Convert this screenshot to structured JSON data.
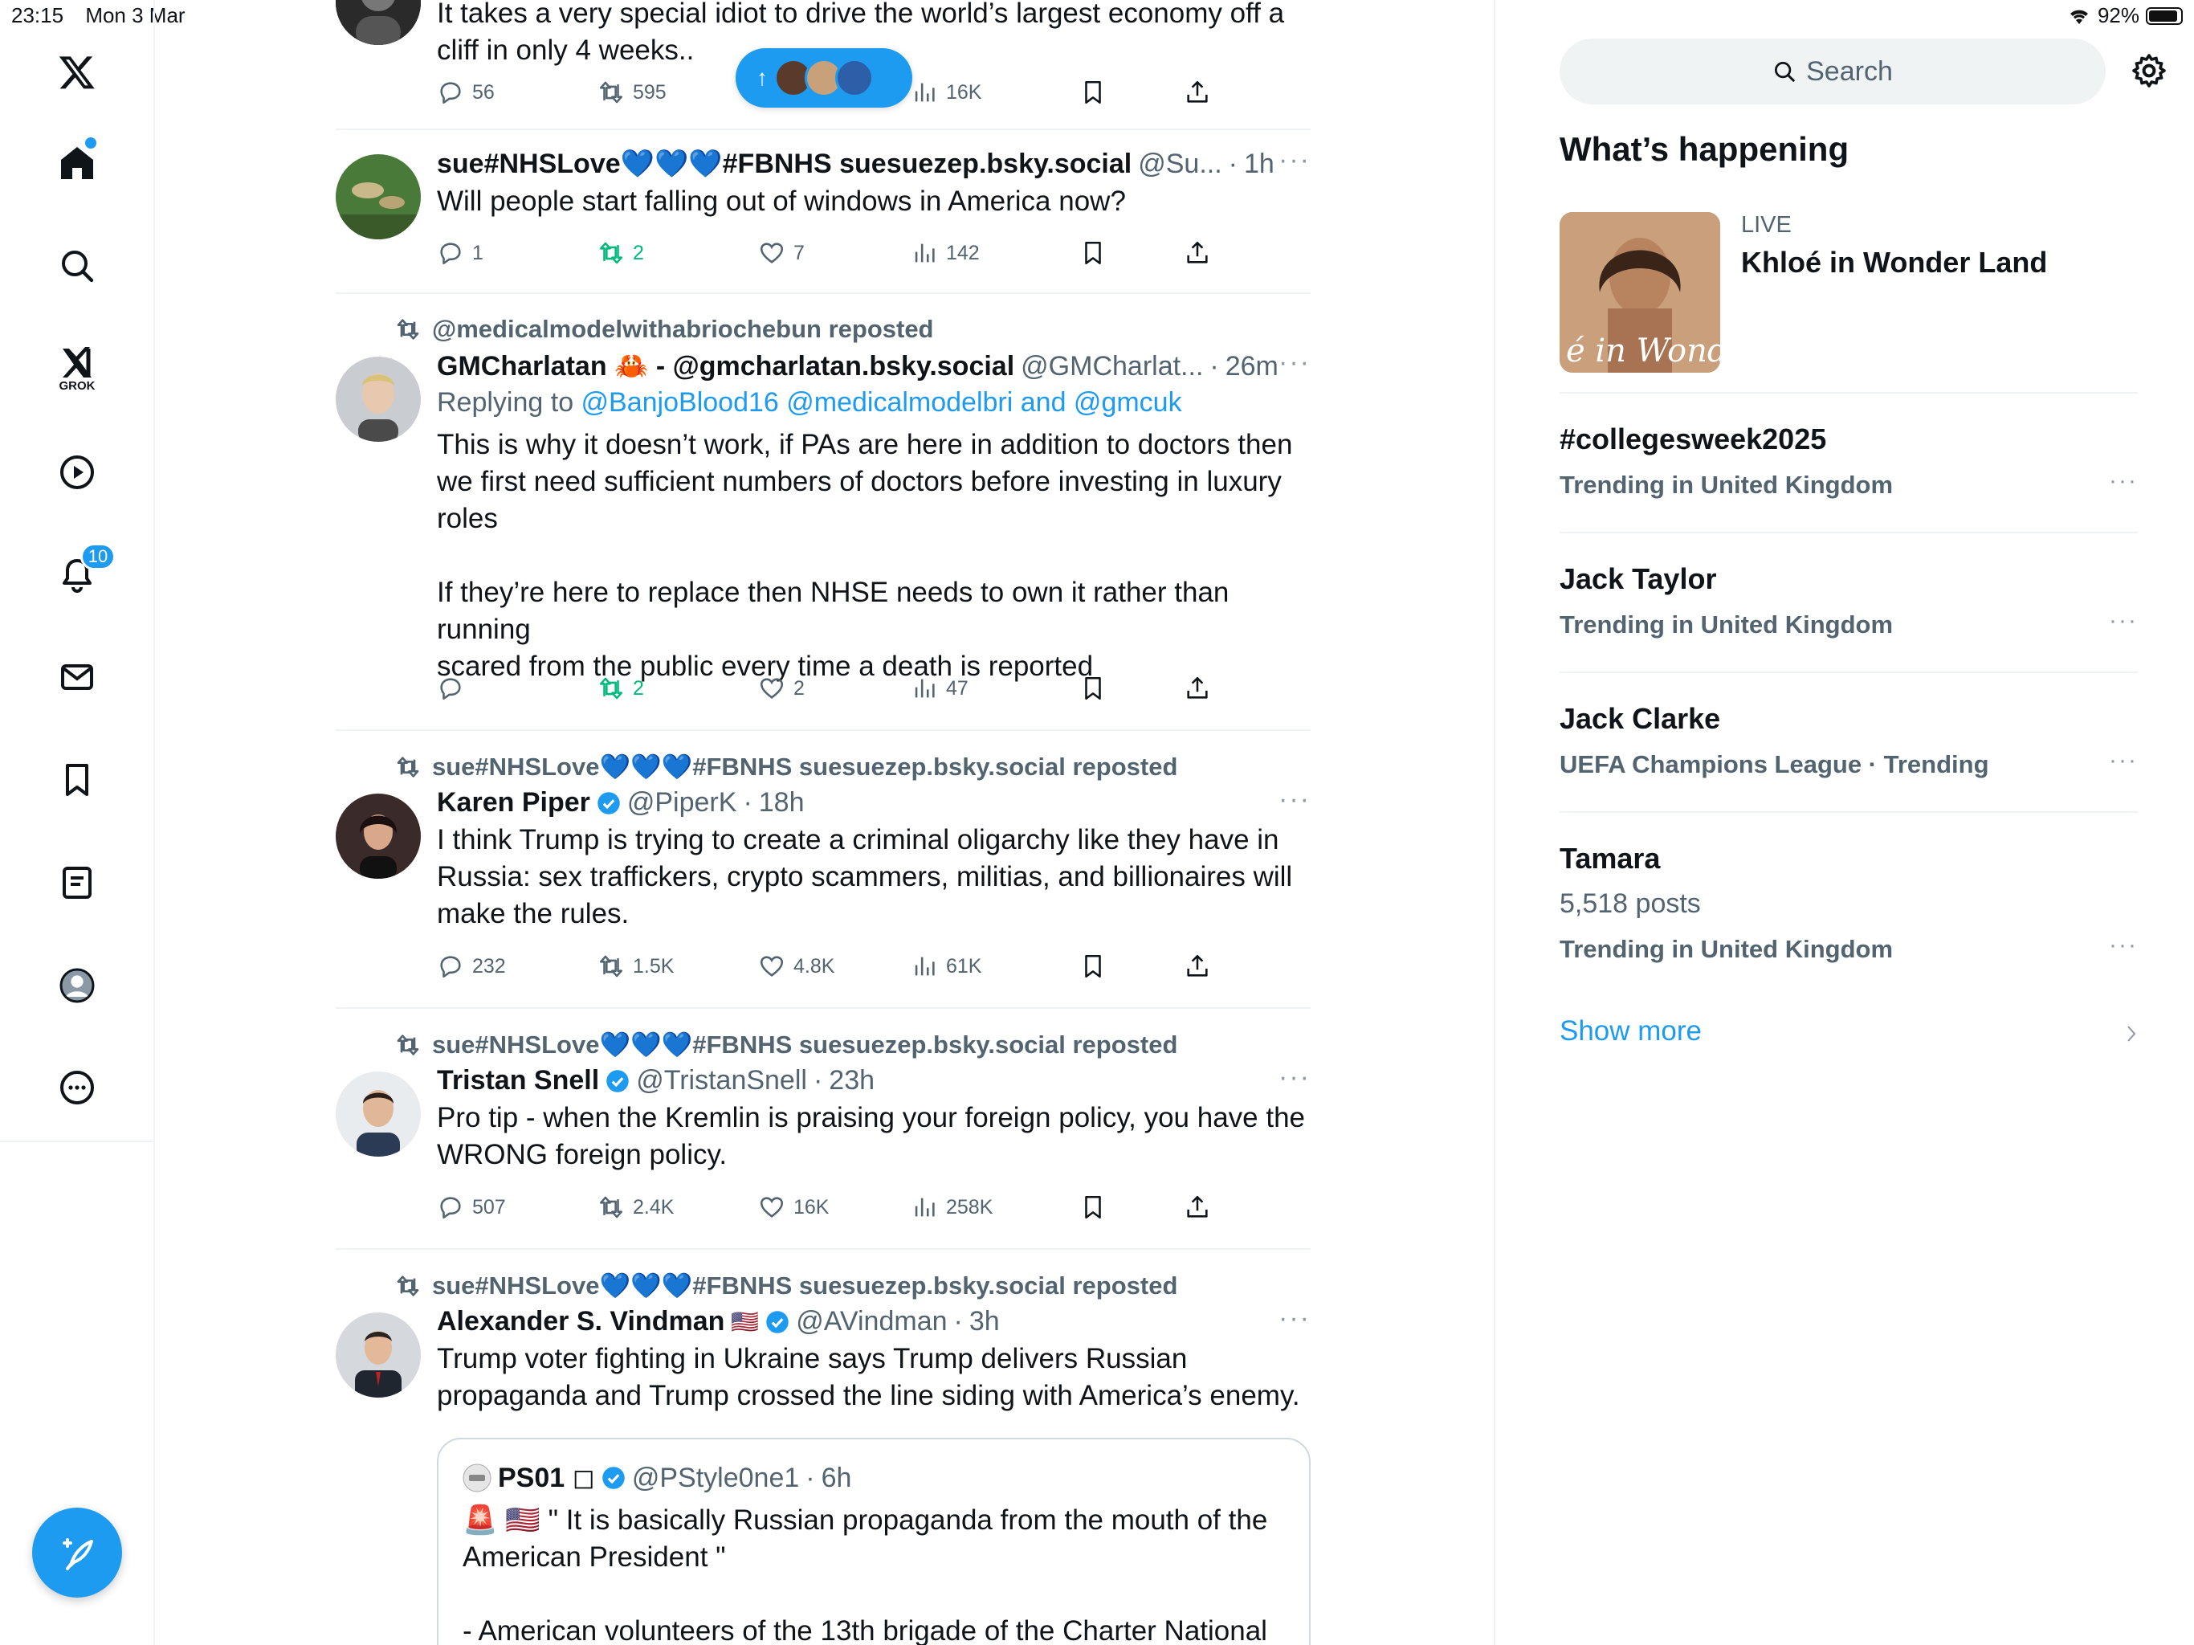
{
  "status_bar": {
    "time": "23:15",
    "date": "Mon 3 Mar",
    "battery": "92%",
    "battery_level": 0.92
  },
  "sidebar": {
    "grok_label": "GROK",
    "notifications_count": "10"
  },
  "new_posts_pill": {
    "arrow": "↑"
  },
  "tweets": [
    {
      "text": "It takes a very special idiot to drive the world’s largest economy off a\ncliff in only 4 weeks..",
      "replies": "56",
      "reposts": "595",
      "views": "16K"
    },
    {
      "name": "sue#NHSLove💙💙💙#FBNHS suesuezep.bsky.social",
      "handle": "@Su...",
      "time": "1h",
      "text": "Will people start falling out of windows in America now?",
      "replies": "1",
      "reposts": "2",
      "likes": "7",
      "views": "142"
    },
    {
      "repost_by": "@medicalmodelwithabriochebun reposted",
      "name": "GMCharlatan 🦀 - @gmcharlatan.bsky.social",
      "handle": "@GMCharlat...",
      "time": "26m",
      "replying_prefix": "Replying to ",
      "replying_to": "@BanjoBlood16 @medicalmodelbri and @gmcuk",
      "text": "This is why it doesn’t work, if PAs are here in addition to doctors then\nwe first need sufficient numbers of doctors before investing in luxury\nroles\n\nIf they’re here to replace then NHSE needs to own it rather than running\nscared from the public every time a death is reported",
      "replies": "",
      "reposts": "2",
      "likes": "2",
      "views": "47"
    },
    {
      "repost_by": "sue#NHSLove💙💙💙#FBNHS suesuezep.bsky.social reposted",
      "name": "Karen Piper",
      "handle": "@PiperK",
      "time": "18h",
      "text": "I think Trump is trying to create a criminal oligarchy like they have in\nRussia: sex traffickers, crypto scammers, militias, and billionaires will\nmake the rules.",
      "replies": "232",
      "reposts": "1.5K",
      "likes": "4.8K",
      "views": "61K"
    },
    {
      "repost_by": "sue#NHSLove💙💙💙#FBNHS suesuezep.bsky.social reposted",
      "name": "Tristan Snell",
      "handle": "@TristanSnell",
      "time": "23h",
      "text": "Pro tip - when the Kremlin is praising your foreign policy, you have the\nWRONG foreign policy.",
      "replies": "507",
      "reposts": "2.4K",
      "likes": "16K",
      "views": "258K"
    },
    {
      "repost_by": "sue#NHSLove💙💙💙#FBNHS suesuezep.bsky.social reposted",
      "name": "Alexander S. Vindman",
      "flag": "🇺🇸",
      "handle": "@AVindman",
      "time": "3h",
      "text": "Trump voter fighting in Ukraine says Trump delivers Russian\npropaganda and Trump crossed the line siding with America’s enemy.",
      "quote": {
        "name": "PS01 ◻",
        "handle": "@PStyle0ne1",
        "time": "6h",
        "text": "🚨 🇺🇸 \" It is basically Russian propaganda from the mouth of the\nAmerican President \"\n\n- American volunteers of the 13th brigade of the Charter National"
      }
    }
  ],
  "sidebar_right": {
    "search_placeholder": "Search",
    "section_title": "What’s happening",
    "live": {
      "label": "LIVE",
      "title": "Khloé in Wonder Land",
      "image_text": "é in Wonder l"
    },
    "trends": [
      {
        "title": "#collegesweek2025",
        "subtitle": "Trending in United Kingdom"
      },
      {
        "title": "Jack Taylor",
        "subtitle": "Trending in United Kingdom"
      },
      {
        "title": "Jack Clarke",
        "subtitle": "UEFA Champions League · Trending"
      },
      {
        "title": "Tamara",
        "posts": "5,518 posts",
        "subtitle": "Trending in United Kingdom"
      }
    ],
    "show_more": "Show more"
  },
  "colors": {
    "accent": "#1d9bf0",
    "repost_green": "#00ba7c",
    "muted": "#536471"
  }
}
